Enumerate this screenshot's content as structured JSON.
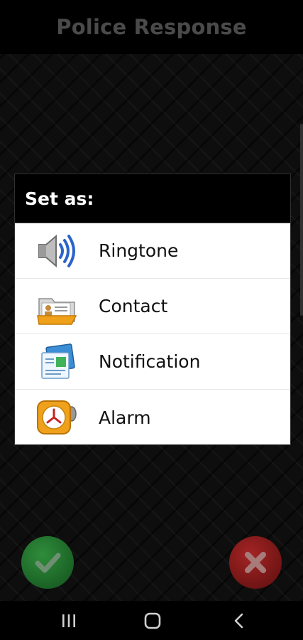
{
  "app": {
    "title": "Police Response"
  },
  "dialog": {
    "title": "Set as:",
    "options": [
      {
        "label": "Ringtone",
        "icon": "speaker-icon"
      },
      {
        "label": "Contact",
        "icon": "contact-folder-icon"
      },
      {
        "label": "Notification",
        "icon": "notification-icon"
      },
      {
        "label": "Alarm",
        "icon": "alarm-clock-icon"
      }
    ]
  },
  "actions": {
    "confirm_icon": "checkmark-icon",
    "cancel_icon": "close-icon",
    "colors": {
      "confirm": "#1f6f2a",
      "cancel": "#8a1a1a"
    }
  },
  "navbar": {
    "items": [
      "recent-apps-icon",
      "home-icon",
      "back-icon"
    ]
  }
}
